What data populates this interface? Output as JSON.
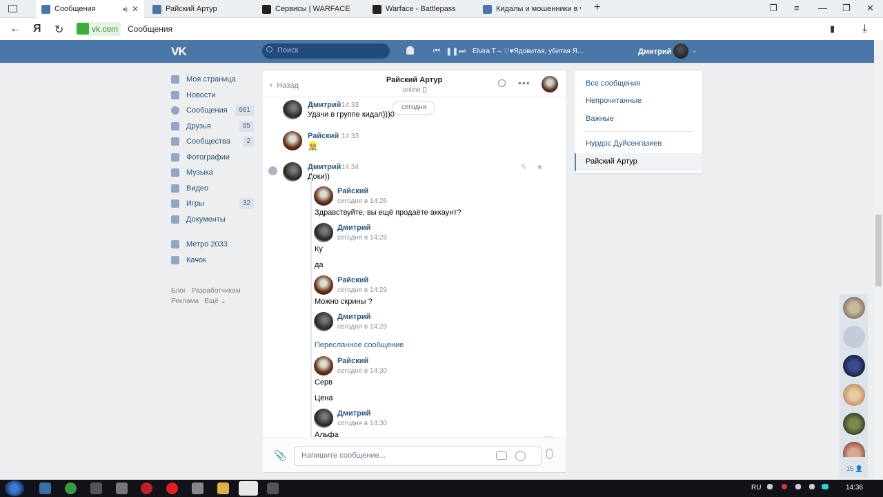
{
  "browser": {
    "tabs": [
      {
        "label": "Сообщения",
        "active": true,
        "icon": "vk-favicon"
      },
      {
        "label": "Райский Артур",
        "active": false,
        "icon": "vk-favicon"
      },
      {
        "label": "Сервисы | WARFACE",
        "active": false,
        "icon": "warface-favicon"
      },
      {
        "label": "Warface - Battlepass",
        "active": false,
        "icon": "warface-favicon"
      },
      {
        "label": "Кидалы и мошенники в vk",
        "active": false,
        "icon": "vk-favicon"
      }
    ],
    "yandex_glyph": "Я",
    "url_host": "vk.com",
    "url_title": "Сообщения"
  },
  "header": {
    "logo": "VK",
    "search_placeholder": "Поиск",
    "track": "Elvira T – ♡♥Ядовитая, убитая Я...",
    "user_name": "Дмитрий"
  },
  "nav": {
    "items": [
      {
        "label": "Моя страница",
        "icon": "home-icon",
        "badge": ""
      },
      {
        "label": "Новости",
        "icon": "news-icon",
        "badge": ""
      },
      {
        "label": "Сообщения",
        "icon": "messages-icon",
        "badge": "661"
      },
      {
        "label": "Друзья",
        "icon": "friends-icon",
        "badge": "85"
      },
      {
        "label": "Сообщества",
        "icon": "groups-icon",
        "badge": "2"
      },
      {
        "label": "Фотографии",
        "icon": "camera-icon",
        "badge": ""
      },
      {
        "label": "Музыка",
        "icon": "music-icon",
        "badge": ""
      },
      {
        "label": "Видео",
        "icon": "video-icon",
        "badge": ""
      },
      {
        "label": "Игры",
        "icon": "games-icon",
        "badge": "32"
      },
      {
        "label": "Документы",
        "icon": "documents-icon",
        "badge": ""
      }
    ],
    "apps": [
      {
        "label": "Метро 2033",
        "icon": "app-icon"
      },
      {
        "label": "Качок",
        "icon": "app-icon"
      }
    ],
    "footer": [
      "Блог",
      "Разработчикам",
      "Реклама",
      "Ещё ⌄"
    ]
  },
  "chat": {
    "back_label": "Назад",
    "name": "Райский Артур",
    "status": "online",
    "date_pill": "сегодня",
    "messages": [
      {
        "author": "Дмитрий",
        "time": "14:33",
        "text": "Удачи в группе кидал)))0"
      },
      {
        "author": "Райский",
        "time": "14:33",
        "text": "👷"
      },
      {
        "author": "Дмитрий",
        "time": "14:34",
        "text": "Доки))"
      }
    ],
    "forwarded": [
      {
        "author": "Райский",
        "time": "сегодня в 14:26",
        "lines": [
          "Здравствуйте, вы ещё продаёте аккаунт?"
        ]
      },
      {
        "author": "Дмитрий",
        "time": "сегодня в 14:28",
        "lines": [
          "Ку",
          "да"
        ]
      },
      {
        "author": "Райский",
        "time": "сегодня в 14:29",
        "lines": [
          "Можно скрины ?"
        ]
      },
      {
        "author": "Дмитрий",
        "time": "сегодня в 14:29",
        "lines": []
      },
      {
        "author": "Райский",
        "time": "сегодня в 14:30",
        "lines": [
          "Серв",
          "Цена"
        ]
      },
      {
        "author": "Дмитрий",
        "time": "сегодня в 14:30",
        "lines": [
          "Альфа"
        ]
      }
    ],
    "forwarded_label": "Пересланное сообщение",
    "composer_placeholder": "Напишите сообщение..."
  },
  "filters": {
    "items": [
      "Все сообщения",
      "Непрочитанные",
      "Важные"
    ],
    "recent": [
      "Нурдос Дуйсенгазиев",
      "Райский Артур"
    ],
    "active": "Райский Артур"
  },
  "contacts": {
    "count": "15"
  },
  "taskbar": {
    "lang": "RU",
    "time": "14:36"
  }
}
